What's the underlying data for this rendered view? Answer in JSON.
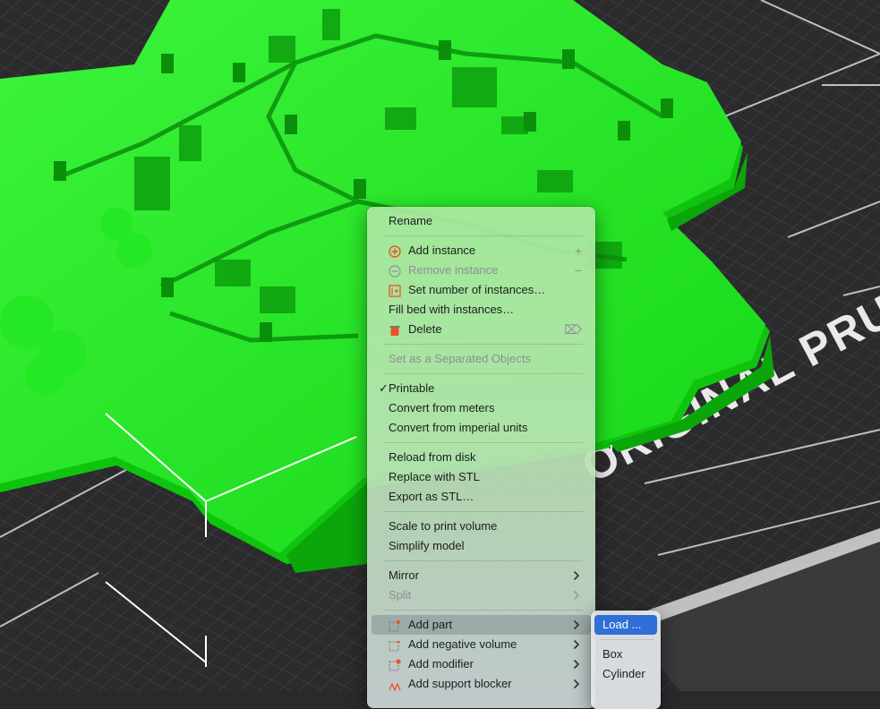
{
  "viewport": {
    "bed_text": "ORIGINAL PRUS",
    "model_color": "#19e619",
    "bed_color": "#2a2a2c"
  },
  "context_menu": {
    "items": [
      {
        "label": "Rename"
      },
      {
        "label": "Add instance",
        "icon": "plus-circle-icon",
        "shortcut": "+"
      },
      {
        "label": "Remove instance",
        "icon": "minus-circle-icon",
        "shortcut": "−",
        "disabled": true
      },
      {
        "label": "Set number of instances…",
        "icon": "instances-icon"
      },
      {
        "label": "Fill bed with instances…"
      },
      {
        "label": "Delete",
        "icon": "trash-icon",
        "shortcut": "⌦"
      },
      {
        "label": "Set as a Separated Objects",
        "disabled": true
      },
      {
        "label": "Printable",
        "checked": true
      },
      {
        "label": "Convert from meters"
      },
      {
        "label": "Convert from imperial units"
      },
      {
        "label": "Reload from disk"
      },
      {
        "label": "Replace with STL"
      },
      {
        "label": "Export as STL…"
      },
      {
        "label": "Scale to print volume"
      },
      {
        "label": "Simplify model"
      },
      {
        "label": "Mirror",
        "submenu": true
      },
      {
        "label": "Split",
        "submenu": true,
        "disabled": true
      },
      {
        "label": "Add part",
        "icon": "add-part-icon",
        "submenu": true,
        "highlighted": true
      },
      {
        "label": "Add negative volume",
        "icon": "add-negative-volume-icon",
        "submenu": true
      },
      {
        "label": "Add modifier",
        "icon": "add-modifier-icon",
        "submenu": true
      },
      {
        "label": "Add support blocker",
        "icon": "add-support-blocker-icon",
        "submenu": true
      }
    ]
  },
  "submenu": {
    "items": [
      {
        "label": "Load ...",
        "selected": true
      },
      {
        "label": "Box"
      },
      {
        "label": "Cylinder"
      }
    ]
  }
}
